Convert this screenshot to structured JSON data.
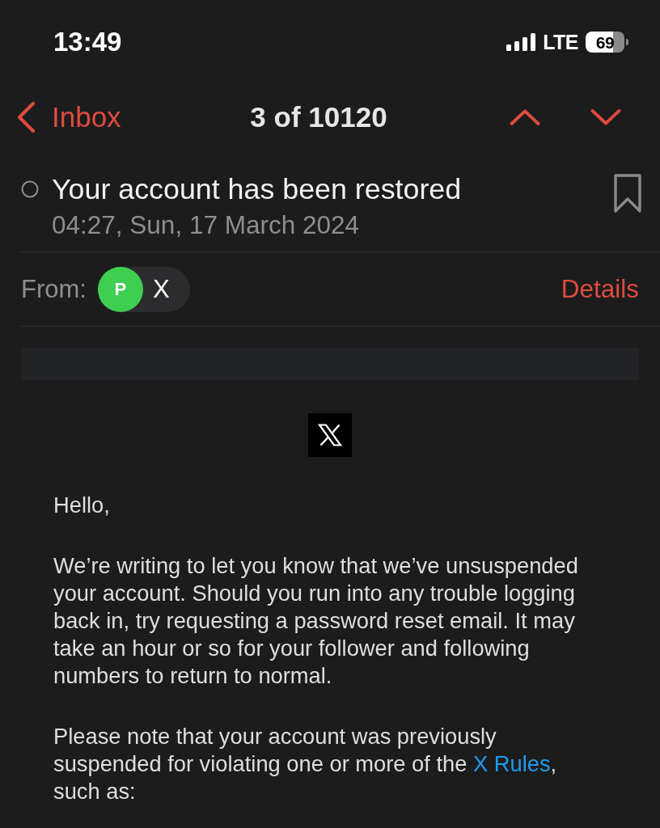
{
  "status_bar": {
    "time": "13:49",
    "network": "LTE",
    "battery": "69"
  },
  "nav_bar": {
    "back_label": "Inbox",
    "title": "3 of 10120"
  },
  "header": {
    "subject": "Your account has been restored",
    "date": "04:27, Sun, 17 March 2024",
    "bookmarked": false
  },
  "from_row": {
    "label": "From:",
    "sender_initial": "P",
    "sender_name": "X",
    "details": "Details"
  },
  "body": {
    "greeting": "Hello,",
    "paragraphs": [
      {
        "text": "We’re writing to let you know that we’ve unsuspended your account. Should you run into any trouble logging back in, try requesting a password reset email. It may take an hour or so for your follower and following numbers to return to normal."
      },
      {
        "text": "Please note that your account was previously suspended for violating one or more of the ",
        "link": "X Rules",
        "text_after": ", such as:"
      }
    ]
  }
}
